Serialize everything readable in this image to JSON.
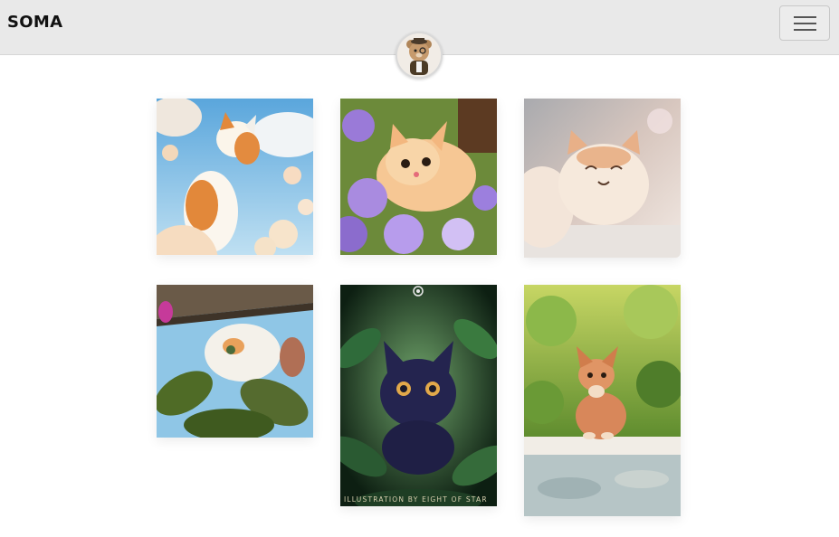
{
  "navbar": {
    "brand": "SOMA",
    "menu_icon": "hamburger-menu-icon",
    "avatar_icon": "teddy-bear-avatar-icon"
  },
  "gallery": {
    "items": [
      {
        "name": "cat-among-flowers-sky",
        "colors": [
          "#8fc4e6",
          "#f4d7a8",
          "#e08a3c"
        ]
      },
      {
        "name": "cat-in-purple-flowers",
        "colors": [
          "#8a6fd1",
          "#f5c48f",
          "#4f8a3a"
        ]
      },
      {
        "name": "smiling-chubby-cat",
        "colors": [
          "#d9c9bf",
          "#f3e3d3",
          "#e7a979"
        ]
      },
      {
        "name": "upside-down-cat-leaves",
        "colors": [
          "#9bcde8",
          "#556b2f",
          "#f2eee6"
        ]
      },
      {
        "name": "black-cat-in-jungle",
        "colors": [
          "#0f2416",
          "#2f6b3a",
          "#26244f"
        ]
      },
      {
        "name": "ginger-cat-on-wall",
        "colors": [
          "#9cc35a",
          "#d8875a",
          "#b8c8cc"
        ]
      }
    ],
    "caption_overlay": "ILLUSTRATION BY EIGHT OF STAR"
  }
}
